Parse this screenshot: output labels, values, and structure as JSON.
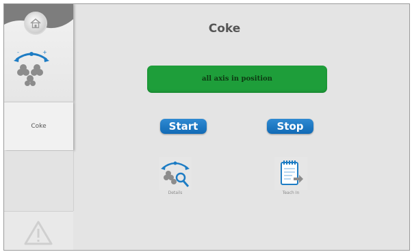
{
  "app": {
    "title": "Coke",
    "status_message": "all axis in position"
  },
  "sidebar": {
    "home_icon": "home-icon",
    "axis_icon": "axis-rotation-icon",
    "items": [
      {
        "label": "Coke"
      }
    ],
    "warning_icon": "warning-icon"
  },
  "controls": {
    "start_label": "Start",
    "stop_label": "Stop"
  },
  "tools": {
    "details_label": "Details",
    "teach_label": "Teach In"
  },
  "colors": {
    "status_green": "#1e9e3a",
    "button_blue": "#1a78c2",
    "background": "#e4e4e4"
  }
}
